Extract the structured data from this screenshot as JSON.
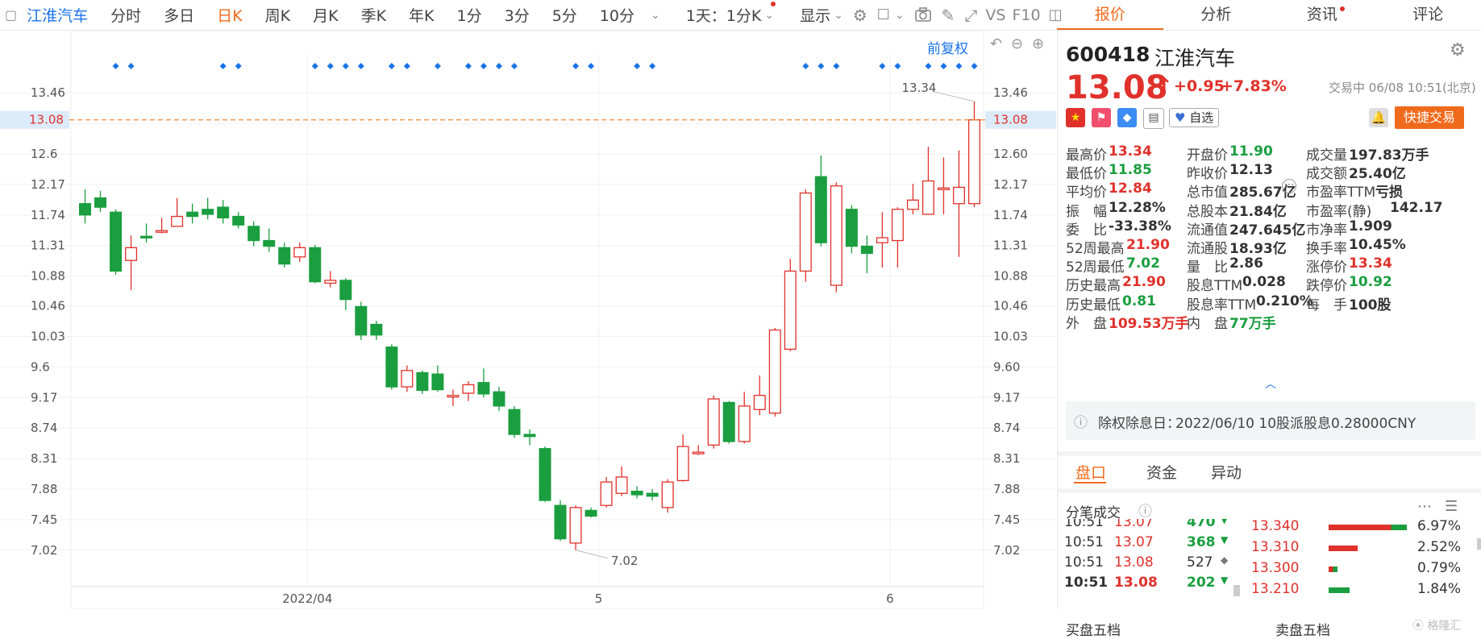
{
  "toolbar": {
    "stock_name": "江淮汽车",
    "periods": [
      "分时",
      "多日",
      "日K",
      "周K",
      "月K",
      "季K",
      "年K",
      "1分",
      "3分",
      "5分",
      "10分"
    ],
    "active_period": "日K",
    "combo": "1天：1分K",
    "display": "显示",
    "vs_label": "VS",
    "f10_label": "F10",
    "adjust": "前复权"
  },
  "right_tabs": [
    "报价",
    "分析",
    "资讯",
    "评论"
  ],
  "quote": {
    "code": "600418",
    "name": "江淮汽车",
    "price": "13.08",
    "arrow": "↑",
    "change": "+0.95",
    "change_pct": "+7.83%",
    "status": "交易中 06/08 10:51(北京)",
    "watch_label": "自选",
    "trade_button": "快捷交易"
  },
  "stats": [
    [
      {
        "label": "最高价",
        "value": "13.34",
        "tone": "up"
      },
      {
        "label": "开盘价",
        "value": "11.90",
        "tone": "down"
      },
      {
        "label": "成交量",
        "value": "197.83万手",
        "tone": "flat"
      }
    ],
    [
      {
        "label": "最低价",
        "value": "11.85",
        "tone": "down"
      },
      {
        "label": "昨收价",
        "value": "12.13",
        "tone": "flat"
      },
      {
        "label": "成交额",
        "value": "25.40亿",
        "tone": "flat"
      }
    ],
    [
      {
        "label": "平均价",
        "value": "12.84",
        "tone": "up"
      },
      {
        "label": "总市值",
        "value": "285.67亿",
        "tone": "flat"
      },
      {
        "label": "市盈率TTM",
        "value": "亏损",
        "tone": "flat"
      }
    ],
    [
      {
        "label": "振　幅",
        "value": "12.28%",
        "tone": "flat"
      },
      {
        "label": "总股本",
        "value": "21.84亿",
        "tone": "flat"
      },
      {
        "label": "市盈率(静)",
        "value": "142.17",
        "tone": "flat"
      }
    ],
    [
      {
        "label": "委　比",
        "value": "-33.38%",
        "tone": "flat"
      },
      {
        "label": "流通值",
        "value": "247.645亿",
        "tone": "flat"
      },
      {
        "label": "市净率",
        "value": "1.909",
        "tone": "flat"
      }
    ],
    [
      {
        "label": "52周最高",
        "value": "21.90",
        "tone": "up"
      },
      {
        "label": "流通股",
        "value": "18.93亿",
        "tone": "flat"
      },
      {
        "label": "换手率",
        "value": "10.45%",
        "tone": "flat"
      }
    ],
    [
      {
        "label": "52周最低",
        "value": "7.02",
        "tone": "down"
      },
      {
        "label": "量　比",
        "value": "2.86",
        "tone": "flat"
      },
      {
        "label": "涨停价",
        "value": "13.34",
        "tone": "up"
      }
    ],
    [
      {
        "label": "历史最高",
        "value": "21.90",
        "tone": "up"
      },
      {
        "label": "股息TTM",
        "value": "0.028",
        "tone": "flat"
      },
      {
        "label": "跌停价",
        "value": "10.92",
        "tone": "down"
      }
    ],
    [
      {
        "label": "历史最低",
        "value": "0.81",
        "tone": "down"
      },
      {
        "label": "股息率TTM",
        "value": "0.210%",
        "tone": "flat"
      },
      {
        "label": "每　手",
        "value": "100股",
        "tone": "flat"
      }
    ],
    [
      {
        "label": "外　盘",
        "value": "109.53万手",
        "tone": "up"
      },
      {
        "label": "内　盘",
        "value": "77万手",
        "tone": "down"
      }
    ]
  ],
  "dividend": {
    "label": "除权除息日：",
    "text": "2022/06/10  10股派股息0.28000CNY"
  },
  "sub_tabs": [
    "盘口",
    "资金",
    "异动"
  ],
  "ticks_title": "分笔成交",
  "ticks": [
    {
      "time": "10:51",
      "price": "13.07",
      "vol": "470",
      "dir": "down"
    },
    {
      "time": "10:51",
      "price": "13.07",
      "vol": "368",
      "dir": "down"
    },
    {
      "time": "10:51",
      "price": "13.08",
      "vol": "527",
      "dir": "flat"
    },
    {
      "time": "10:51",
      "price": "13.08",
      "vol": "202",
      "dir": "down"
    }
  ],
  "price_dist": [
    {
      "price": "13.340",
      "pct": "6.97%",
      "frac": 0.97
    },
    {
      "price": "13.310",
      "pct": "2.52%",
      "frac": 0.36
    },
    {
      "price": "13.300",
      "pct": "0.79%",
      "frac": 0.11
    },
    {
      "price": "13.210",
      "pct": "1.84%",
      "frac": 0.26
    }
  ],
  "bottom_labels": [
    "买盘五档",
    "卖盘五档"
  ],
  "chart_data": {
    "type": "candlestick",
    "y_ticks": [
      13.46,
      13.03,
      12.6,
      12.17,
      11.74,
      11.31,
      10.88,
      10.46,
      10.03,
      9.6,
      9.17,
      8.74,
      8.31,
      7.88,
      7.45,
      7.02
    ],
    "ylim": [
      6.62,
      13.86
    ],
    "current_price": "13.08",
    "x_labels": [
      "2022/04",
      "5",
      "6"
    ],
    "x_label_index": [
      15,
      34,
      53
    ],
    "high_label": "13.34",
    "low_label": "7.02",
    "candles": [
      [
        11.9,
        11.74,
        12.1,
        11.62
      ],
      [
        11.98,
        11.85,
        12.08,
        11.78
      ],
      [
        11.78,
        10.95,
        11.82,
        10.9
      ],
      [
        11.1,
        11.28,
        11.45,
        10.68
      ],
      [
        11.44,
        11.42,
        11.62,
        11.35
      ],
      [
        11.52,
        11.52,
        11.7,
        11.48
      ],
      [
        11.58,
        11.72,
        11.98,
        11.6
      ],
      [
        11.78,
        11.72,
        11.9,
        11.62
      ],
      [
        11.82,
        11.75,
        11.98,
        11.68
      ],
      [
        11.85,
        11.7,
        11.95,
        11.62
      ],
      [
        11.72,
        11.6,
        11.78,
        11.55
      ],
      [
        11.58,
        11.38,
        11.65,
        11.3
      ],
      [
        11.38,
        11.3,
        11.55,
        11.22
      ],
      [
        11.28,
        11.05,
        11.35,
        11.0
      ],
      [
        11.15,
        11.28,
        11.35,
        11.08
      ],
      [
        11.28,
        10.8,
        11.32,
        10.78
      ],
      [
        10.78,
        10.82,
        10.95,
        10.72
      ],
      [
        10.82,
        10.55,
        10.85,
        10.4
      ],
      [
        10.45,
        10.05,
        10.52,
        9.98
      ],
      [
        10.2,
        10.05,
        10.25,
        9.98
      ],
      [
        9.88,
        9.32,
        9.92,
        9.28
      ],
      [
        9.32,
        9.55,
        9.62,
        9.25
      ],
      [
        9.52,
        9.27,
        9.55,
        9.22
      ],
      [
        9.5,
        9.28,
        9.62,
        9.25
      ],
      [
        9.18,
        9.2,
        9.28,
        9.05
      ],
      [
        9.23,
        9.35,
        9.4,
        9.12
      ],
      [
        9.38,
        9.22,
        9.58,
        9.17
      ],
      [
        9.25,
        9.05,
        9.32,
        8.98
      ],
      [
        9.0,
        8.65,
        9.05,
        8.6
      ],
      [
        8.65,
        8.62,
        8.72,
        8.5
      ],
      [
        8.45,
        7.72,
        8.48,
        7.7
      ],
      [
        7.65,
        7.18,
        7.72,
        7.15
      ],
      [
        7.12,
        7.62,
        7.65,
        7.02
      ],
      [
        7.58,
        7.5,
        7.62,
        7.48
      ],
      [
        7.65,
        7.98,
        8.05,
        7.62
      ],
      [
        7.82,
        8.05,
        8.2,
        7.78
      ],
      [
        7.85,
        7.8,
        7.92,
        7.75
      ],
      [
        7.82,
        7.78,
        7.88,
        7.72
      ],
      [
        7.62,
        7.98,
        8.02,
        7.55
      ],
      [
        8.0,
        8.48,
        8.65,
        7.98
      ],
      [
        8.4,
        8.4,
        8.5,
        8.36
      ],
      [
        8.5,
        9.15,
        9.2,
        8.45
      ],
      [
        9.1,
        8.55,
        9.12,
        8.52
      ],
      [
        8.55,
        9.05,
        9.25,
        8.52
      ],
      [
        9.0,
        9.2,
        9.48,
        8.92
      ],
      [
        8.95,
        10.12,
        10.15,
        8.9
      ],
      [
        9.85,
        10.95,
        11.12,
        9.82
      ],
      [
        10.95,
        12.05,
        12.1,
        10.8
      ],
      [
        12.28,
        11.35,
        12.58,
        11.3
      ],
      [
        10.75,
        12.15,
        12.2,
        10.65
      ],
      [
        11.82,
        11.3,
        11.88,
        11.2
      ],
      [
        11.3,
        11.2,
        11.45,
        10.92
      ],
      [
        11.35,
        11.42,
        11.78,
        11.0
      ],
      [
        11.38,
        11.82,
        11.85,
        11.0
      ],
      [
        11.82,
        11.95,
        12.18,
        11.75
      ],
      [
        11.75,
        12.22,
        12.7,
        11.75
      ],
      [
        12.1,
        12.12,
        12.55,
        11.75
      ],
      [
        11.9,
        12.13,
        12.65,
        11.15
      ],
      [
        11.9,
        13.08,
        13.34,
        11.85
      ]
    ],
    "markers": [
      2,
      3,
      9,
      10,
      15,
      16,
      17,
      18,
      20,
      21,
      23,
      25,
      26,
      27,
      28,
      32,
      33,
      36,
      37,
      47,
      48,
      49,
      52,
      53,
      55,
      56,
      57,
      58
    ]
  }
}
